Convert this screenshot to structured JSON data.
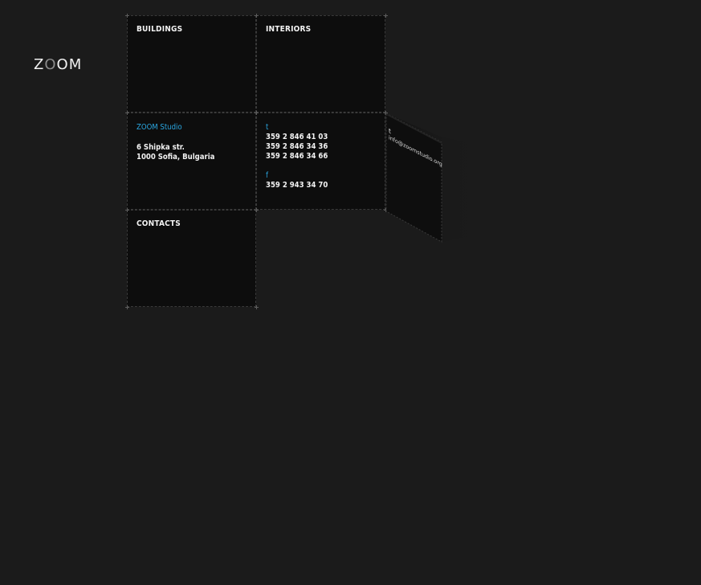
{
  "logo": {
    "part1": "Z",
    "part2": "O",
    "part3": "O",
    "part4": "M"
  },
  "nav": {
    "buildings": "BUILDINGS",
    "interiors": "INTERIORS",
    "contacts": "CONTACTS"
  },
  "address": {
    "studio": "ZOOM Studio",
    "street": "6 Shipka str.",
    "city": "1000 Sofia, Bulgaria"
  },
  "phones": {
    "t_label": "t",
    "t1": "359 2 846 41 03",
    "t2": "359 2 846 34 36",
    "t3": "359 2 846 34 66",
    "f_label": "f",
    "f1": "359 2 943 34 70"
  },
  "email": {
    "label": "t",
    "address": "info@zoomstudio.org"
  },
  "colors": {
    "accent": "#2aa6e0",
    "background": "#1b1b1b",
    "cell": "#0d0d0d"
  }
}
